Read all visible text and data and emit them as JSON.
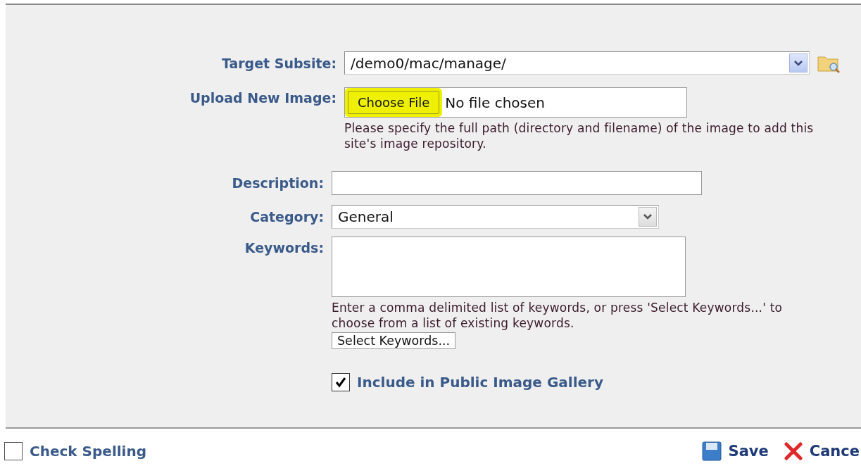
{
  "form": {
    "target_subsite": {
      "label": "Target Subsite:",
      "value": "/demo0/mac/manage/"
    },
    "upload": {
      "label": "Upload New Image:",
      "button": "Choose File",
      "status": "No file chosen",
      "highlighted": true,
      "help": "Please specify the full path (directory and filename) of the image to add this site's image repository."
    },
    "description": {
      "label": "Description:"
    },
    "category": {
      "label": "Category:",
      "value": "General"
    },
    "keywords": {
      "label": "Keywords:",
      "help": "Enter a comma delimited list of keywords, or press 'Select Keywords...' to choose from a list of existing keywords.",
      "button": "Select Keywords..."
    },
    "gallery": {
      "label": "Include in Public Image Gallery",
      "checked": true
    }
  },
  "footer": {
    "check_spelling": {
      "label": "Check Spelling",
      "checked": false
    },
    "actions": [
      {
        "kind": "save",
        "label": "Save"
      },
      {
        "kind": "cancel",
        "label": "Cance"
      }
    ]
  }
}
